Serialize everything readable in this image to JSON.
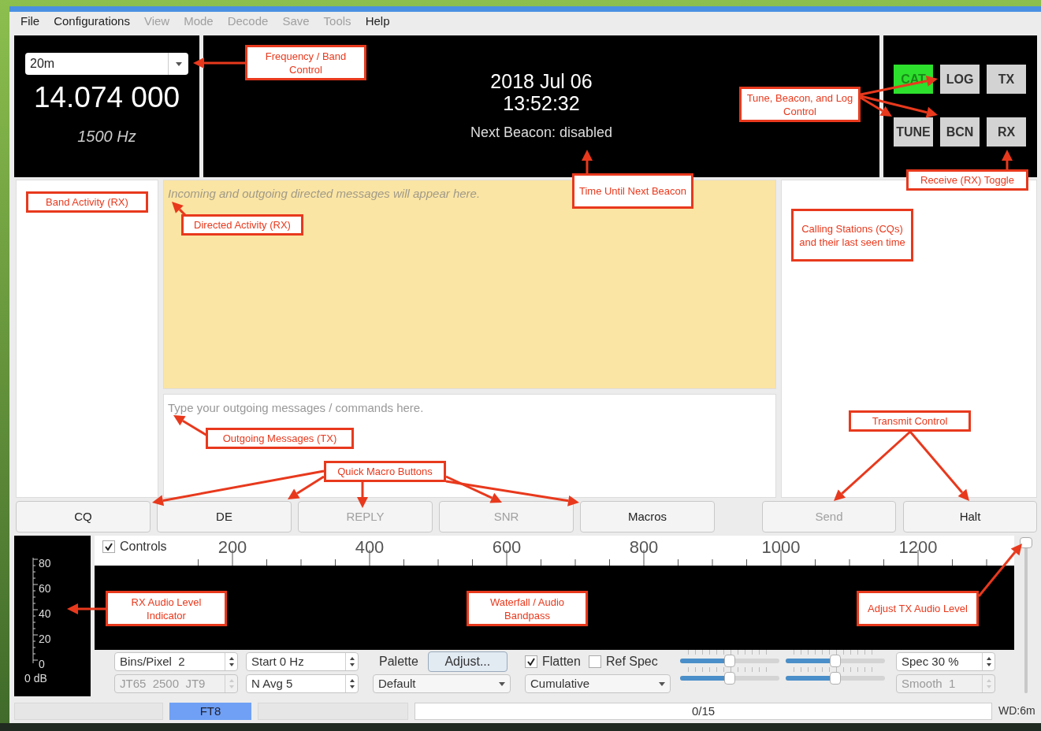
{
  "menu": [
    {
      "label": "File",
      "disabled": false
    },
    {
      "label": "Configurations",
      "disabled": false
    },
    {
      "label": "View",
      "disabled": true
    },
    {
      "label": "Mode",
      "disabled": true
    },
    {
      "label": "Decode",
      "disabled": true
    },
    {
      "label": "Save",
      "disabled": true
    },
    {
      "label": "Tools",
      "disabled": true
    },
    {
      "label": "Help",
      "disabled": false
    }
  ],
  "band": {
    "value": "20m",
    "frequency": "14.074 000",
    "offset": "1500 Hz"
  },
  "clock": {
    "date": "2018 Jul 06",
    "time": "13:52:32",
    "beacon": "Next Beacon: disabled"
  },
  "toggles": [
    {
      "label": "CAT",
      "on": true
    },
    {
      "label": "LOG",
      "on": false
    },
    {
      "label": "TX",
      "on": false
    },
    {
      "label": "TUNE",
      "on": false
    },
    {
      "label": "BCN",
      "on": false
    },
    {
      "label": "RX",
      "on": false
    }
  ],
  "directed": {
    "placeholder": "Incoming and outgoing directed messages will appear here."
  },
  "outgoing": {
    "placeholder": "Type your outgoing messages / commands here."
  },
  "macro_buttons": [
    {
      "label": "CQ",
      "disabled": false
    },
    {
      "label": "DE",
      "disabled": false
    },
    {
      "label": "REPLY",
      "disabled": true
    },
    {
      "label": "SNR",
      "disabled": true
    },
    {
      "label": "Macros",
      "disabled": false
    }
  ],
  "transmit_buttons": [
    {
      "label": "Send",
      "disabled": true
    },
    {
      "label": "Halt",
      "disabled": false
    }
  ],
  "meter": {
    "ticks": [
      "80",
      "60",
      "40",
      "20",
      "0"
    ],
    "reading": "0 dB"
  },
  "waterfall": {
    "controls_toggle": {
      "label": "Controls",
      "checked": true
    },
    "scale": [
      "200",
      "400",
      "600",
      "800",
      "1000",
      "1200"
    ]
  },
  "controls": {
    "bins": {
      "value": "Bins/Pixel  2",
      "disabled": false
    },
    "submode": {
      "value": "JT65  2500  JT9",
      "disabled": true
    },
    "start": {
      "value": "Start 0 Hz",
      "disabled": false
    },
    "navg": {
      "value": "N Avg 5",
      "disabled": false
    },
    "palette_label": "Palette",
    "adjust": "Adjust...",
    "palette": "Default",
    "flatten": {
      "label": "Flatten",
      "checked": true
    },
    "ref_spec": {
      "label": "Ref Spec",
      "checked": false
    },
    "spectrum": "Cumulative",
    "sliders": [
      {
        "level": 0.5
      },
      {
        "level": 0.5
      },
      {
        "level": 0.5
      },
      {
        "level": 0.5
      }
    ],
    "spec": {
      "value": "Spec 30 %",
      "disabled": false
    },
    "smooth": {
      "value": "Smooth  1",
      "disabled": true
    }
  },
  "tx_level": {
    "level": 1.0
  },
  "status_bar": {
    "mode": "FT8",
    "progress": "0/15",
    "watchdog": "WD:6m"
  },
  "annotations": [
    {
      "text": "Frequency / Band Control"
    },
    {
      "text": "Tune, Beacon, and Log Control"
    },
    {
      "text": "Receive (RX) Toggle"
    },
    {
      "text": "Time Until Next Beacon"
    },
    {
      "text": "Band Activity (RX)"
    },
    {
      "text": "Directed Activity (RX)"
    },
    {
      "text": "Calling Stations (CQs) and their last seen time"
    },
    {
      "text": "Outgoing Messages (TX)"
    },
    {
      "text": "Transmit Control"
    },
    {
      "text": "Quick Macro Buttons"
    },
    {
      "text": "RX Audio Level Indicator"
    },
    {
      "text": "Waterfall / Audio Bandpass"
    },
    {
      "text": "Adjust TX Audio Level"
    }
  ]
}
